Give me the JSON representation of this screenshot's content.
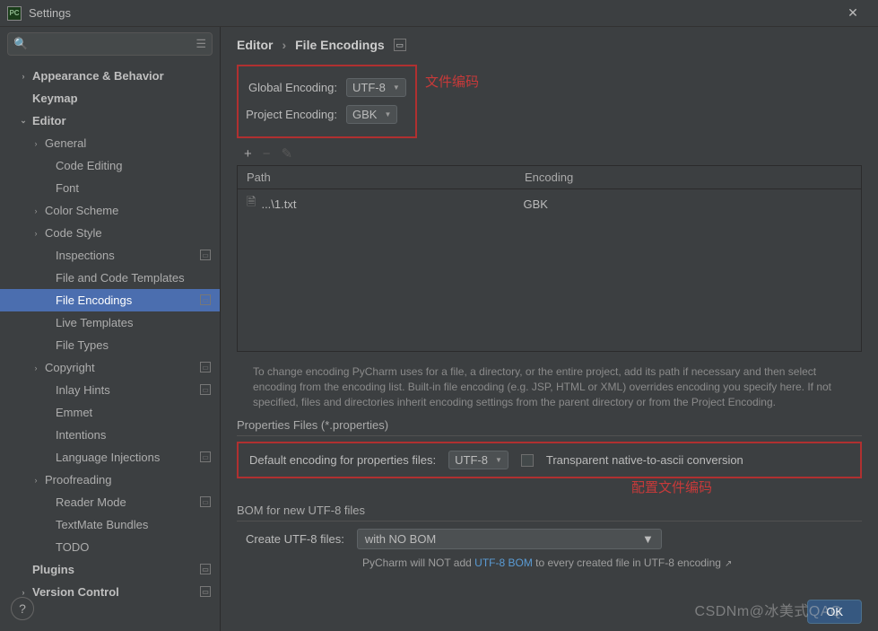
{
  "window": {
    "title": "Settings"
  },
  "search": {
    "placeholder": ""
  },
  "sidebar": {
    "items": [
      {
        "label": "Appearance & Behavior",
        "lvl": 1,
        "chev": "›",
        "bold": true
      },
      {
        "label": "Keymap",
        "lvl": 1,
        "bold": true
      },
      {
        "label": "Editor",
        "lvl": 1,
        "chev": "⌄",
        "bold": true
      },
      {
        "label": "General",
        "lvl": 2,
        "chev": "›"
      },
      {
        "label": "Code Editing",
        "lvl": 3
      },
      {
        "label": "Font",
        "lvl": 3
      },
      {
        "label": "Color Scheme",
        "lvl": 2,
        "chev": "›"
      },
      {
        "label": "Code Style",
        "lvl": 2,
        "chev": "›"
      },
      {
        "label": "Inspections",
        "lvl": 3,
        "mark": true
      },
      {
        "label": "File and Code Templates",
        "lvl": 3
      },
      {
        "label": "File Encodings",
        "lvl": 3,
        "sel": true,
        "mark": true
      },
      {
        "label": "Live Templates",
        "lvl": 3
      },
      {
        "label": "File Types",
        "lvl": 3
      },
      {
        "label": "Copyright",
        "lvl": 2,
        "chev": "›",
        "mark": true
      },
      {
        "label": "Inlay Hints",
        "lvl": 3,
        "mark": true
      },
      {
        "label": "Emmet",
        "lvl": 3
      },
      {
        "label": "Intentions",
        "lvl": 3
      },
      {
        "label": "Language Injections",
        "lvl": 3,
        "mark": true
      },
      {
        "label": "Proofreading",
        "lvl": 2,
        "chev": "›"
      },
      {
        "label": "Reader Mode",
        "lvl": 3,
        "mark": true
      },
      {
        "label": "TextMate Bundles",
        "lvl": 3
      },
      {
        "label": "TODO",
        "lvl": 3
      },
      {
        "label": "Plugins",
        "lvl": 1,
        "bold": true,
        "mark": true
      },
      {
        "label": "Version Control",
        "lvl": 1,
        "chev": "›",
        "bold": true,
        "mark": true
      }
    ]
  },
  "breadcrumb": {
    "root": "Editor",
    "current": "File Encodings"
  },
  "enc": {
    "global_label": "Global Encoding:",
    "global_value": "UTF-8",
    "project_label": "Project Encoding:",
    "project_value": "GBK",
    "annotation1": "文件编码"
  },
  "table": {
    "headers": {
      "path": "Path",
      "enc": "Encoding"
    },
    "rows": [
      {
        "path": "...\\1.txt",
        "enc": "GBK"
      }
    ]
  },
  "note": "To change encoding PyCharm uses for a file, a directory, or the entire project, add its path if necessary and then select encoding from the encoding list. Built-in file encoding (e.g. JSP, HTML or XML) overrides encoding you specify here. If not specified, files and directories inherit encoding settings from the parent directory or from the Project Encoding.",
  "props": {
    "section": "Properties Files (*.properties)",
    "label": "Default encoding for properties files:",
    "value": "UTF-8",
    "checkbox_label": "Transparent native-to-ascii conversion",
    "annotation2": "配置文件编码"
  },
  "bom": {
    "section": "BOM for new UTF-8 files",
    "label": "Create UTF-8 files:",
    "value": "with NO BOM",
    "hint_pre": "PyCharm will NOT add ",
    "hint_link": "UTF-8 BOM",
    "hint_post": " to every created file in UTF-8 encoding"
  },
  "buttons": {
    "ok": "OK"
  },
  "watermark": "CSDNm@冰美式QAQ"
}
